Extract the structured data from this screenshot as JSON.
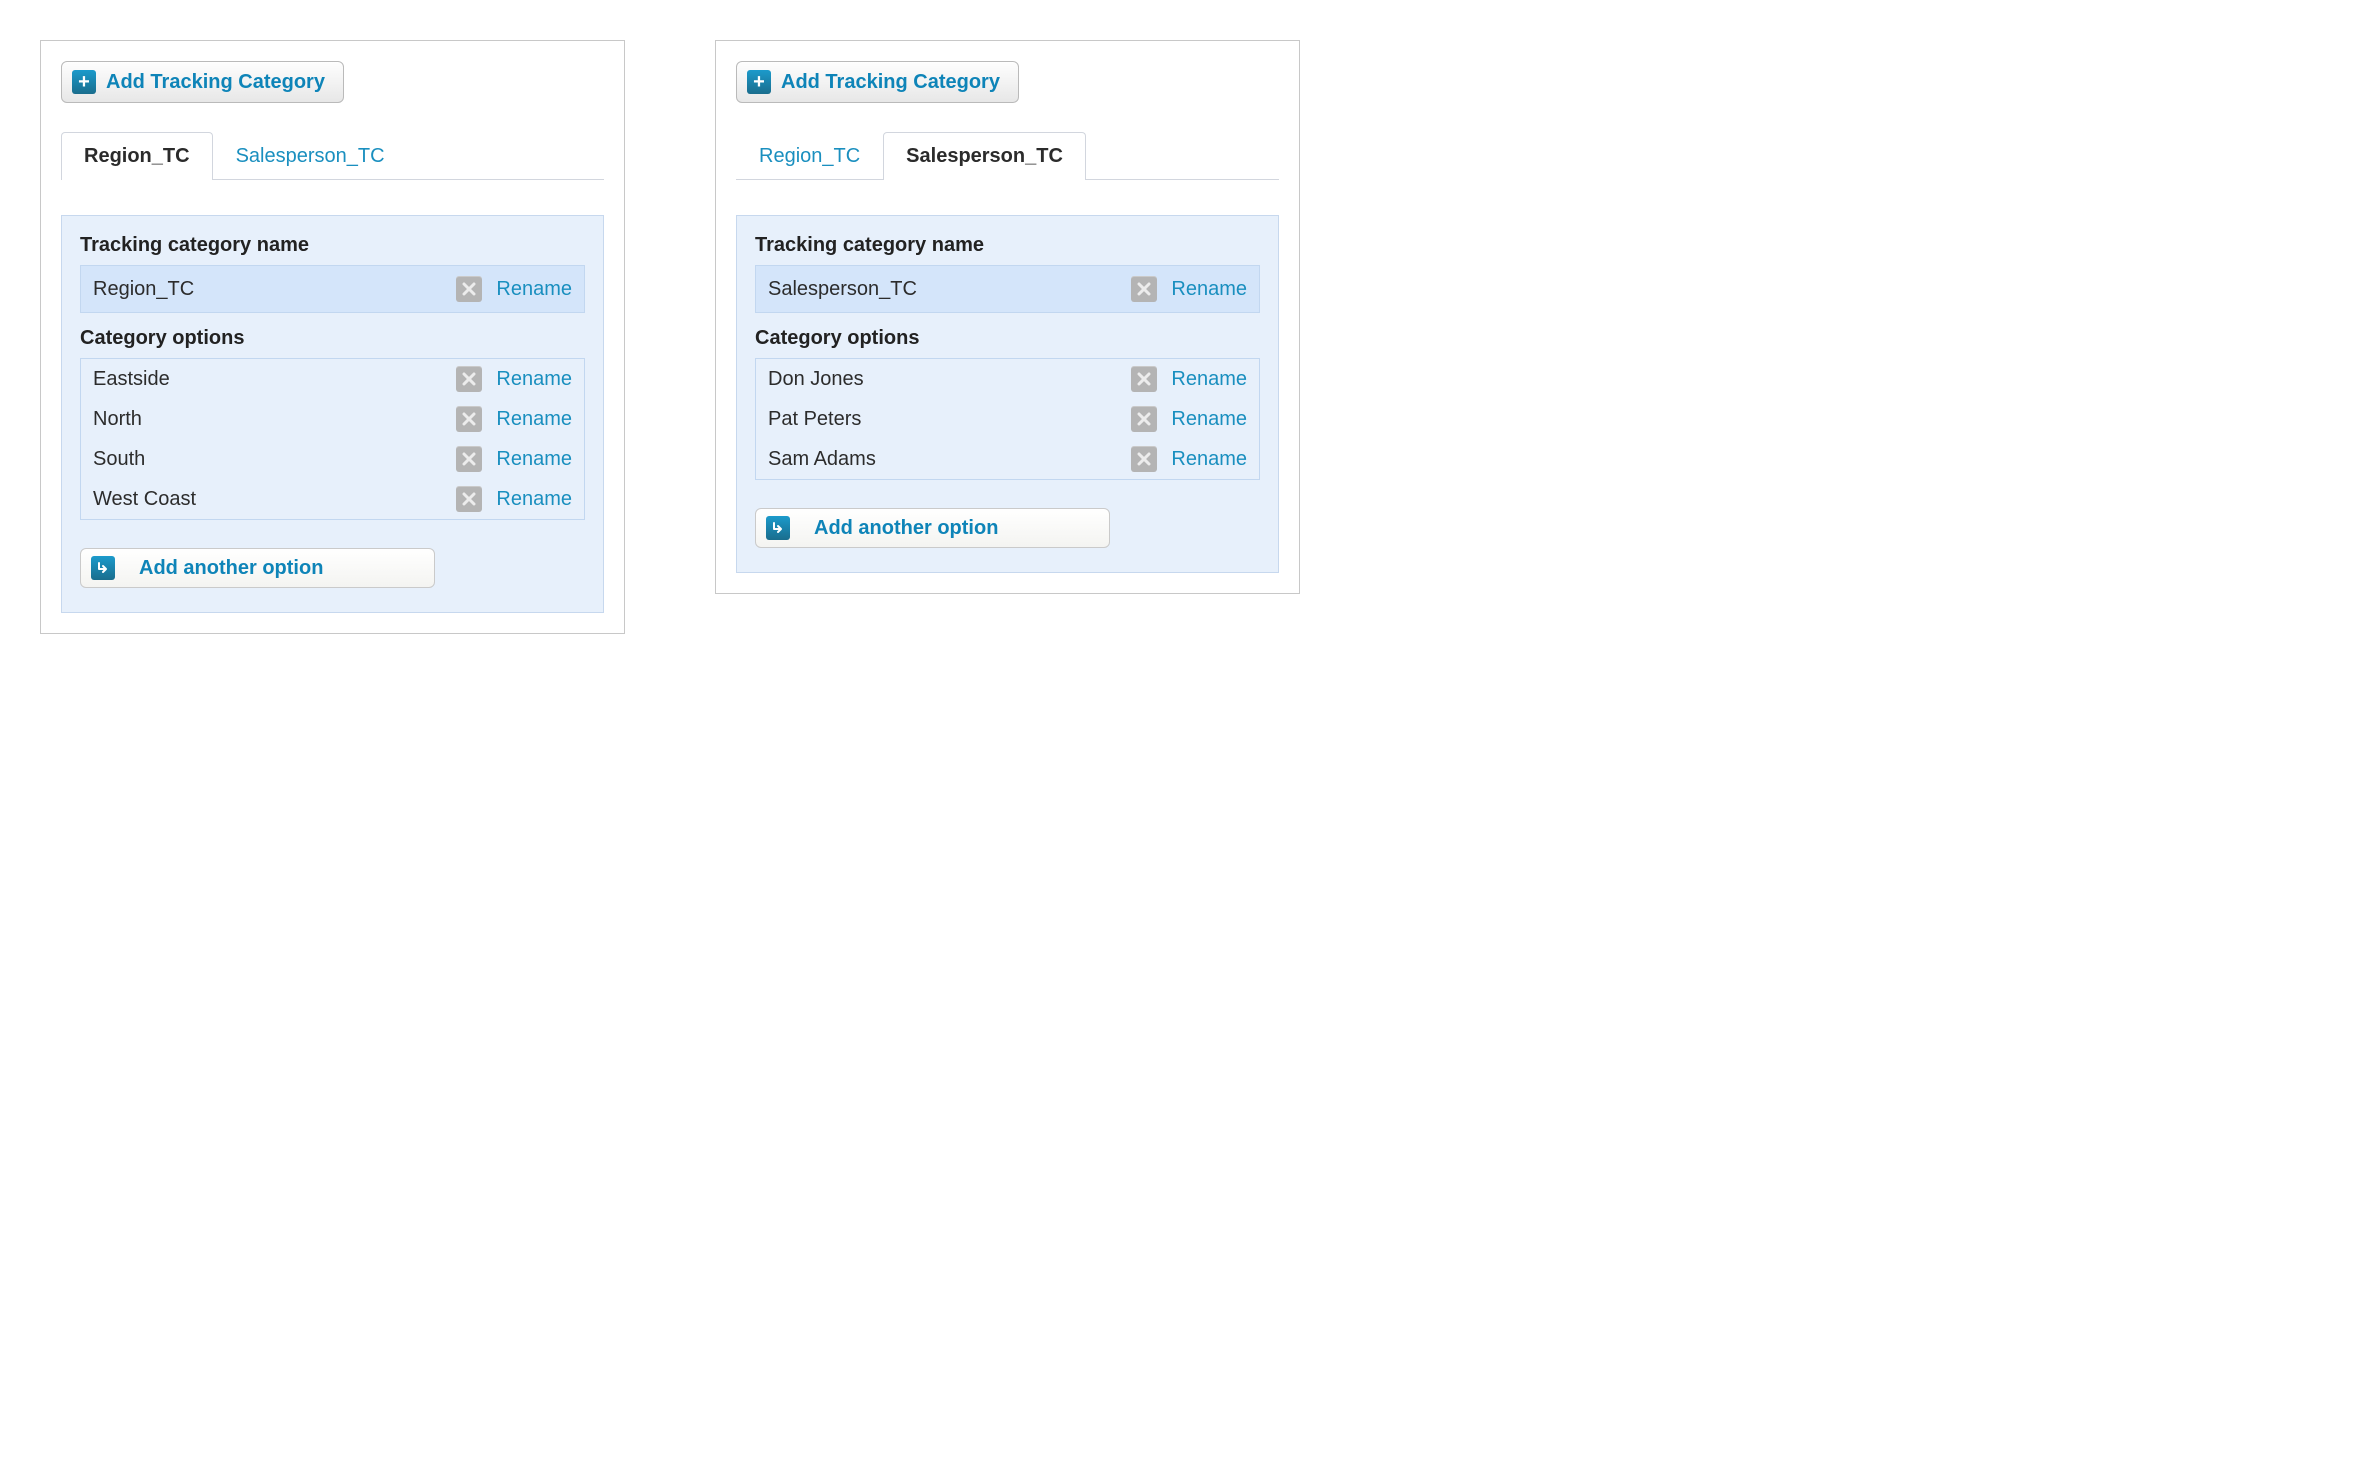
{
  "panels": [
    {
      "addCategoryLabel": "Add Tracking Category",
      "tabs": {
        "region": "Region_TC",
        "salesperson": "Salesperson_TC"
      },
      "activeTab": "region",
      "sections": {
        "nameLabel": "Tracking category name",
        "optionsLabel": "Category options"
      },
      "categoryName": "Region_TC",
      "renameLabel": "Rename",
      "options": [
        "Eastside",
        "North",
        "South",
        "West Coast"
      ],
      "addOptionLabel": "Add another option"
    },
    {
      "addCategoryLabel": "Add Tracking Category",
      "tabs": {
        "region": "Region_TC",
        "salesperson": "Salesperson_TC"
      },
      "activeTab": "salesperson",
      "sections": {
        "nameLabel": "Tracking category name",
        "optionsLabel": "Category options"
      },
      "categoryName": "Salesperson_TC",
      "renameLabel": "Rename",
      "options": [
        "Don Jones",
        "Pat Peters",
        "Sam Adams"
      ],
      "addOptionLabel": "Add another option"
    }
  ]
}
